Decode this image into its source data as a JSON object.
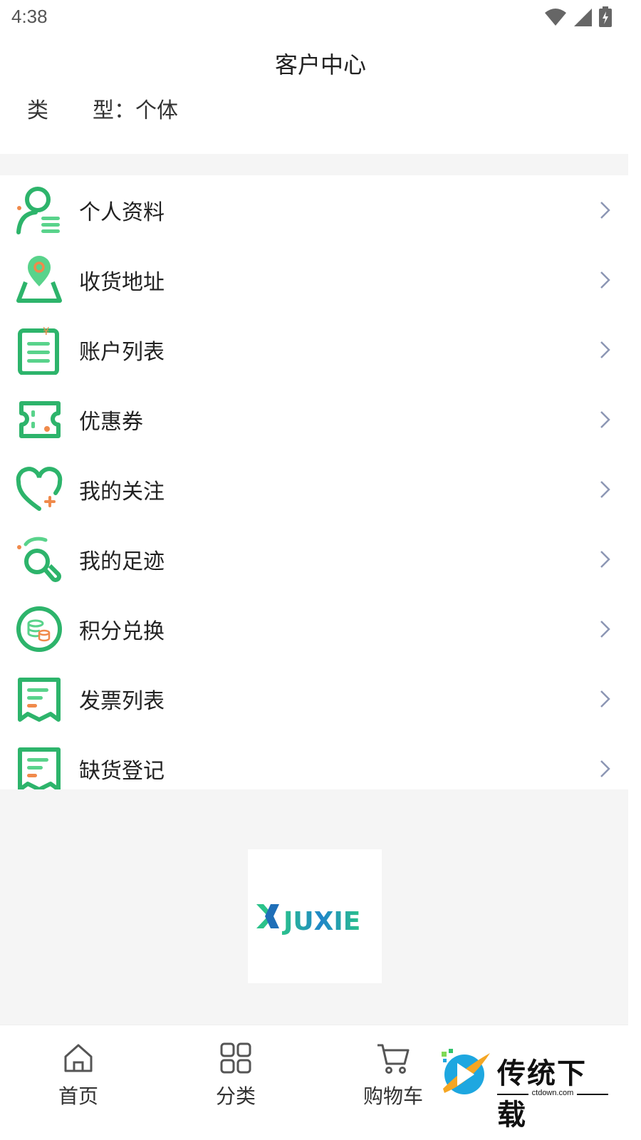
{
  "status_bar": {
    "time": "4:38",
    "icons": [
      "wifi-icon",
      "signal-icon",
      "battery-charging-icon"
    ]
  },
  "header": {
    "title": "客户中心"
  },
  "customer_type": {
    "label_chars": [
      "类",
      "型"
    ],
    "separator": "：",
    "value": "个体"
  },
  "menu": {
    "items": [
      {
        "label": "个人资料",
        "icon": "profile-icon"
      },
      {
        "label": "收货地址",
        "icon": "location-pin-icon"
      },
      {
        "label": "账户列表",
        "icon": "account-list-icon"
      },
      {
        "label": "优惠券",
        "icon": "coupon-icon"
      },
      {
        "label": "我的关注",
        "icon": "heart-plus-icon"
      },
      {
        "label": "我的足迹",
        "icon": "footprint-icon"
      },
      {
        "label": "积分兑换",
        "icon": "coins-icon"
      },
      {
        "label": "发票列表",
        "icon": "invoice-icon"
      },
      {
        "label": "缺货登记",
        "icon": "stockout-register-icon"
      }
    ]
  },
  "brand": {
    "logo_text": "JUXIE"
  },
  "tabbar": {
    "items": [
      {
        "label": "首页",
        "icon": "home-icon"
      },
      {
        "label": "分类",
        "icon": "category-grid-icon"
      },
      {
        "label": "购物车",
        "icon": "cart-icon"
      }
    ]
  },
  "watermark": {
    "title": "传统下载",
    "subtitle": "ctdown.com"
  },
  "colors": {
    "accent_green": "#2DB46B",
    "accent_orange": "#F08A4B",
    "chevron": "#8C96B4",
    "band_gray": "#F5F5F5"
  }
}
